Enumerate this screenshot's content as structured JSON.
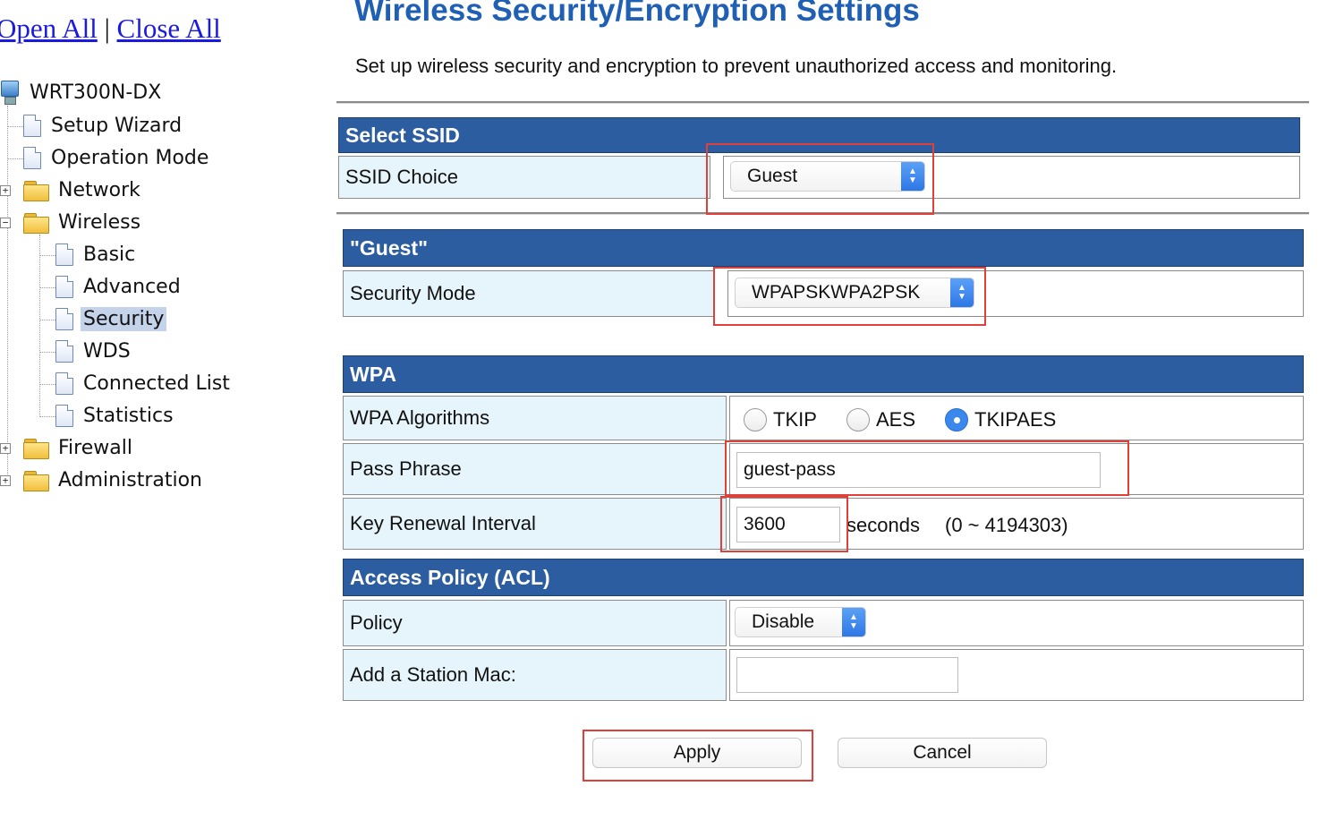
{
  "tree": {
    "open_all": "Open All",
    "separator": "|",
    "close_all": "Close All",
    "root": "WRT300N-DX",
    "items": [
      {
        "label": "Setup Wizard"
      },
      {
        "label": "Operation Mode"
      },
      {
        "label": "Network"
      },
      {
        "label": "Wireless"
      },
      {
        "label": "Basic"
      },
      {
        "label": "Advanced"
      },
      {
        "label": "Security",
        "selected": true
      },
      {
        "label": "WDS"
      },
      {
        "label": "Connected List"
      },
      {
        "label": "Statistics"
      },
      {
        "label": "Firewall"
      },
      {
        "label": "Administration"
      }
    ]
  },
  "page": {
    "title": "Wireless Security/Encryption Settings",
    "description": "Set up wireless security and encryption to prevent unauthorized access and monitoring."
  },
  "ssid_section": {
    "header": "Select SSID",
    "label": "SSID Choice",
    "value": "Guest"
  },
  "guest_section": {
    "header": "\"Guest\"",
    "label": "Security Mode",
    "value": "WPAPSKWPA2PSK"
  },
  "wpa_section": {
    "header": "WPA",
    "algorithms_label": "WPA Algorithms",
    "algorithms": [
      {
        "label": "TKIP",
        "checked": false
      },
      {
        "label": "AES",
        "checked": false
      },
      {
        "label": "TKIPAES",
        "checked": true
      }
    ],
    "pass_label": "Pass Phrase",
    "pass_value": "guest-pass",
    "renewal_label": "Key Renewal Interval",
    "renewal_value": "3600",
    "renewal_unit": "seconds",
    "renewal_range": "(0 ~ 4194303)"
  },
  "acl_section": {
    "header": "Access Policy (ACL)",
    "policy_label": "Policy",
    "policy_value": "Disable",
    "mac_label": "Add a Station Mac:",
    "mac_value": ""
  },
  "buttons": {
    "apply": "Apply",
    "cancel": "Cancel"
  },
  "colors": {
    "header_bg": "#2c5da0",
    "label_bg": "#e6f4fb",
    "title": "#1f5fb4",
    "highlight": "#e0403a",
    "link": "#1a1ae0"
  }
}
